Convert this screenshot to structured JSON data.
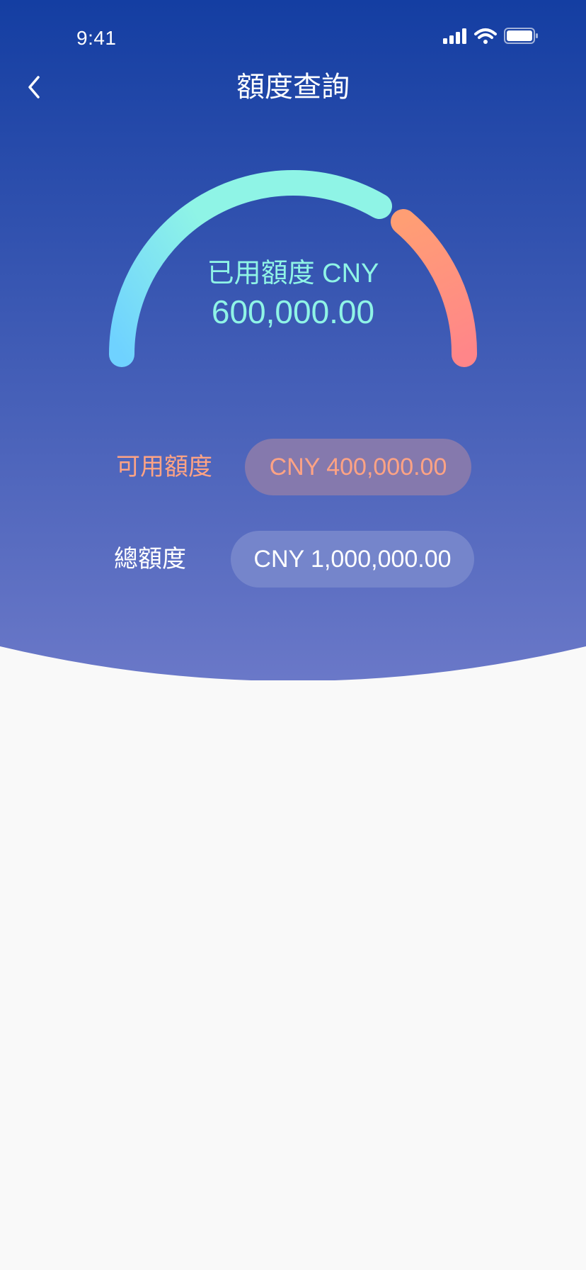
{
  "status_bar": {
    "time": "9:41",
    "icons": [
      "signal-icon",
      "wifi-icon",
      "battery-icon"
    ]
  },
  "nav": {
    "back_icon": "chevron-left-icon",
    "title": "額度查詢"
  },
  "gauge": {
    "label": "已用額度 CNY",
    "value": "600,000.00",
    "used_fraction": 0.6,
    "colors": {
      "used_start": "#6fd2ff",
      "used_end": "#8ff4e6",
      "remaining_start": "#ff9e74",
      "remaining_end": "#ff8689"
    }
  },
  "summary": {
    "available": {
      "label": "可用額度",
      "value": "CNY 400,000.00"
    },
    "total": {
      "label": "總額度",
      "value": "CNY 1,000,000.00"
    }
  },
  "colors": {
    "header_top": "#143ea2",
    "header_bottom": "#6a78c8",
    "page_background": "#f9f9f9",
    "accent_cyan": "#8ff4e6",
    "accent_orange": "#ffa384"
  }
}
